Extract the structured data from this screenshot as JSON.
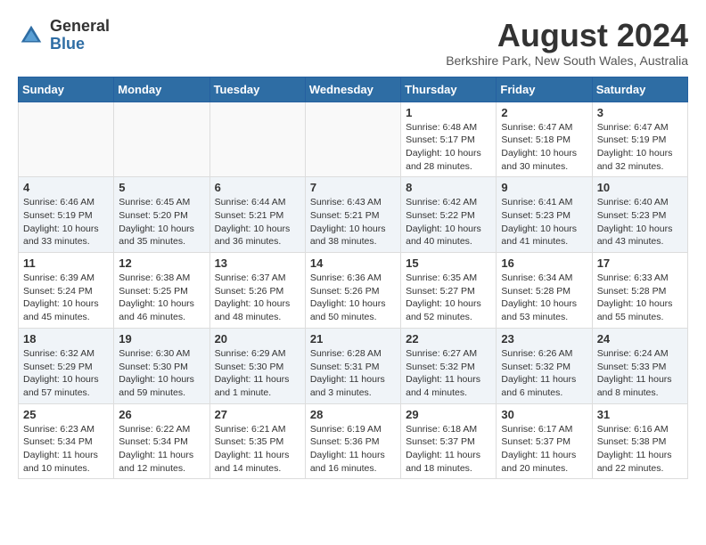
{
  "header": {
    "logo_general": "General",
    "logo_blue": "Blue",
    "month_year": "August 2024",
    "location": "Berkshire Park, New South Wales, Australia"
  },
  "days_of_week": [
    "Sunday",
    "Monday",
    "Tuesday",
    "Wednesday",
    "Thursday",
    "Friday",
    "Saturday"
  ],
  "weeks": [
    [
      {
        "day": "",
        "info": ""
      },
      {
        "day": "",
        "info": ""
      },
      {
        "day": "",
        "info": ""
      },
      {
        "day": "",
        "info": ""
      },
      {
        "day": "1",
        "info": "Sunrise: 6:48 AM\nSunset: 5:17 PM\nDaylight: 10 hours\nand 28 minutes."
      },
      {
        "day": "2",
        "info": "Sunrise: 6:47 AM\nSunset: 5:18 PM\nDaylight: 10 hours\nand 30 minutes."
      },
      {
        "day": "3",
        "info": "Sunrise: 6:47 AM\nSunset: 5:19 PM\nDaylight: 10 hours\nand 32 minutes."
      }
    ],
    [
      {
        "day": "4",
        "info": "Sunrise: 6:46 AM\nSunset: 5:19 PM\nDaylight: 10 hours\nand 33 minutes."
      },
      {
        "day": "5",
        "info": "Sunrise: 6:45 AM\nSunset: 5:20 PM\nDaylight: 10 hours\nand 35 minutes."
      },
      {
        "day": "6",
        "info": "Sunrise: 6:44 AM\nSunset: 5:21 PM\nDaylight: 10 hours\nand 36 minutes."
      },
      {
        "day": "7",
        "info": "Sunrise: 6:43 AM\nSunset: 5:21 PM\nDaylight: 10 hours\nand 38 minutes."
      },
      {
        "day": "8",
        "info": "Sunrise: 6:42 AM\nSunset: 5:22 PM\nDaylight: 10 hours\nand 40 minutes."
      },
      {
        "day": "9",
        "info": "Sunrise: 6:41 AM\nSunset: 5:23 PM\nDaylight: 10 hours\nand 41 minutes."
      },
      {
        "day": "10",
        "info": "Sunrise: 6:40 AM\nSunset: 5:23 PM\nDaylight: 10 hours\nand 43 minutes."
      }
    ],
    [
      {
        "day": "11",
        "info": "Sunrise: 6:39 AM\nSunset: 5:24 PM\nDaylight: 10 hours\nand 45 minutes."
      },
      {
        "day": "12",
        "info": "Sunrise: 6:38 AM\nSunset: 5:25 PM\nDaylight: 10 hours\nand 46 minutes."
      },
      {
        "day": "13",
        "info": "Sunrise: 6:37 AM\nSunset: 5:26 PM\nDaylight: 10 hours\nand 48 minutes."
      },
      {
        "day": "14",
        "info": "Sunrise: 6:36 AM\nSunset: 5:26 PM\nDaylight: 10 hours\nand 50 minutes."
      },
      {
        "day": "15",
        "info": "Sunrise: 6:35 AM\nSunset: 5:27 PM\nDaylight: 10 hours\nand 52 minutes."
      },
      {
        "day": "16",
        "info": "Sunrise: 6:34 AM\nSunset: 5:28 PM\nDaylight: 10 hours\nand 53 minutes."
      },
      {
        "day": "17",
        "info": "Sunrise: 6:33 AM\nSunset: 5:28 PM\nDaylight: 10 hours\nand 55 minutes."
      }
    ],
    [
      {
        "day": "18",
        "info": "Sunrise: 6:32 AM\nSunset: 5:29 PM\nDaylight: 10 hours\nand 57 minutes."
      },
      {
        "day": "19",
        "info": "Sunrise: 6:30 AM\nSunset: 5:30 PM\nDaylight: 10 hours\nand 59 minutes."
      },
      {
        "day": "20",
        "info": "Sunrise: 6:29 AM\nSunset: 5:30 PM\nDaylight: 11 hours\nand 1 minute."
      },
      {
        "day": "21",
        "info": "Sunrise: 6:28 AM\nSunset: 5:31 PM\nDaylight: 11 hours\nand 3 minutes."
      },
      {
        "day": "22",
        "info": "Sunrise: 6:27 AM\nSunset: 5:32 PM\nDaylight: 11 hours\nand 4 minutes."
      },
      {
        "day": "23",
        "info": "Sunrise: 6:26 AM\nSunset: 5:32 PM\nDaylight: 11 hours\nand 6 minutes."
      },
      {
        "day": "24",
        "info": "Sunrise: 6:24 AM\nSunset: 5:33 PM\nDaylight: 11 hours\nand 8 minutes."
      }
    ],
    [
      {
        "day": "25",
        "info": "Sunrise: 6:23 AM\nSunset: 5:34 PM\nDaylight: 11 hours\nand 10 minutes."
      },
      {
        "day": "26",
        "info": "Sunrise: 6:22 AM\nSunset: 5:34 PM\nDaylight: 11 hours\nand 12 minutes."
      },
      {
        "day": "27",
        "info": "Sunrise: 6:21 AM\nSunset: 5:35 PM\nDaylight: 11 hours\nand 14 minutes."
      },
      {
        "day": "28",
        "info": "Sunrise: 6:19 AM\nSunset: 5:36 PM\nDaylight: 11 hours\nand 16 minutes."
      },
      {
        "day": "29",
        "info": "Sunrise: 6:18 AM\nSunset: 5:37 PM\nDaylight: 11 hours\nand 18 minutes."
      },
      {
        "day": "30",
        "info": "Sunrise: 6:17 AM\nSunset: 5:37 PM\nDaylight: 11 hours\nand 20 minutes."
      },
      {
        "day": "31",
        "info": "Sunrise: 6:16 AM\nSunset: 5:38 PM\nDaylight: 11 hours\nand 22 minutes."
      }
    ]
  ]
}
